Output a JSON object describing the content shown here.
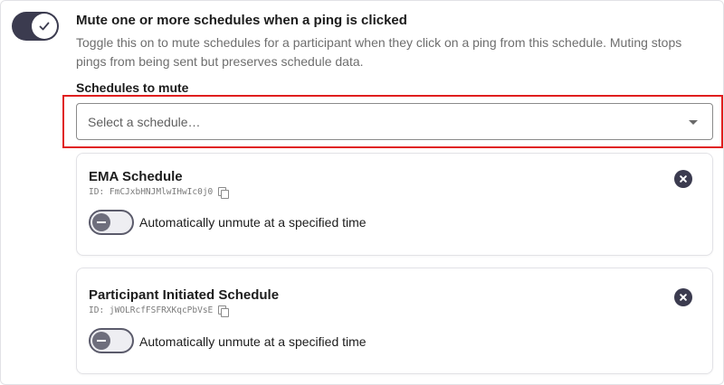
{
  "setting": {
    "title": "Mute one or more schedules when a ping is clicked",
    "description": "Toggle this on to mute schedules for a participant when they click on a ping from this schedule. Muting stops pings from being sent but preserves schedule data.",
    "enabled": true
  },
  "schedules_field": {
    "label": "Schedules to mute",
    "placeholder": "Select a schedule…"
  },
  "schedules": [
    {
      "name": "EMA Schedule",
      "id_text": "ID: FmCJxbHNJMlwIHwIc0j0",
      "unmute_label": "Automatically unmute at a specified time",
      "auto_unmute": false
    },
    {
      "name": "Participant Initiated Schedule",
      "id_text": "ID: jWOLRcfFSFRXKqcPbVsE",
      "unmute_label": "Automatically unmute at a specified time",
      "auto_unmute": false
    }
  ],
  "colors": {
    "toggle_on": "#3b3b4f",
    "highlight": "#e01e1e"
  },
  "icons": {
    "check": "check-icon",
    "close": "close-circle-icon",
    "copy": "copy-icon",
    "caret": "caret-down-icon"
  }
}
